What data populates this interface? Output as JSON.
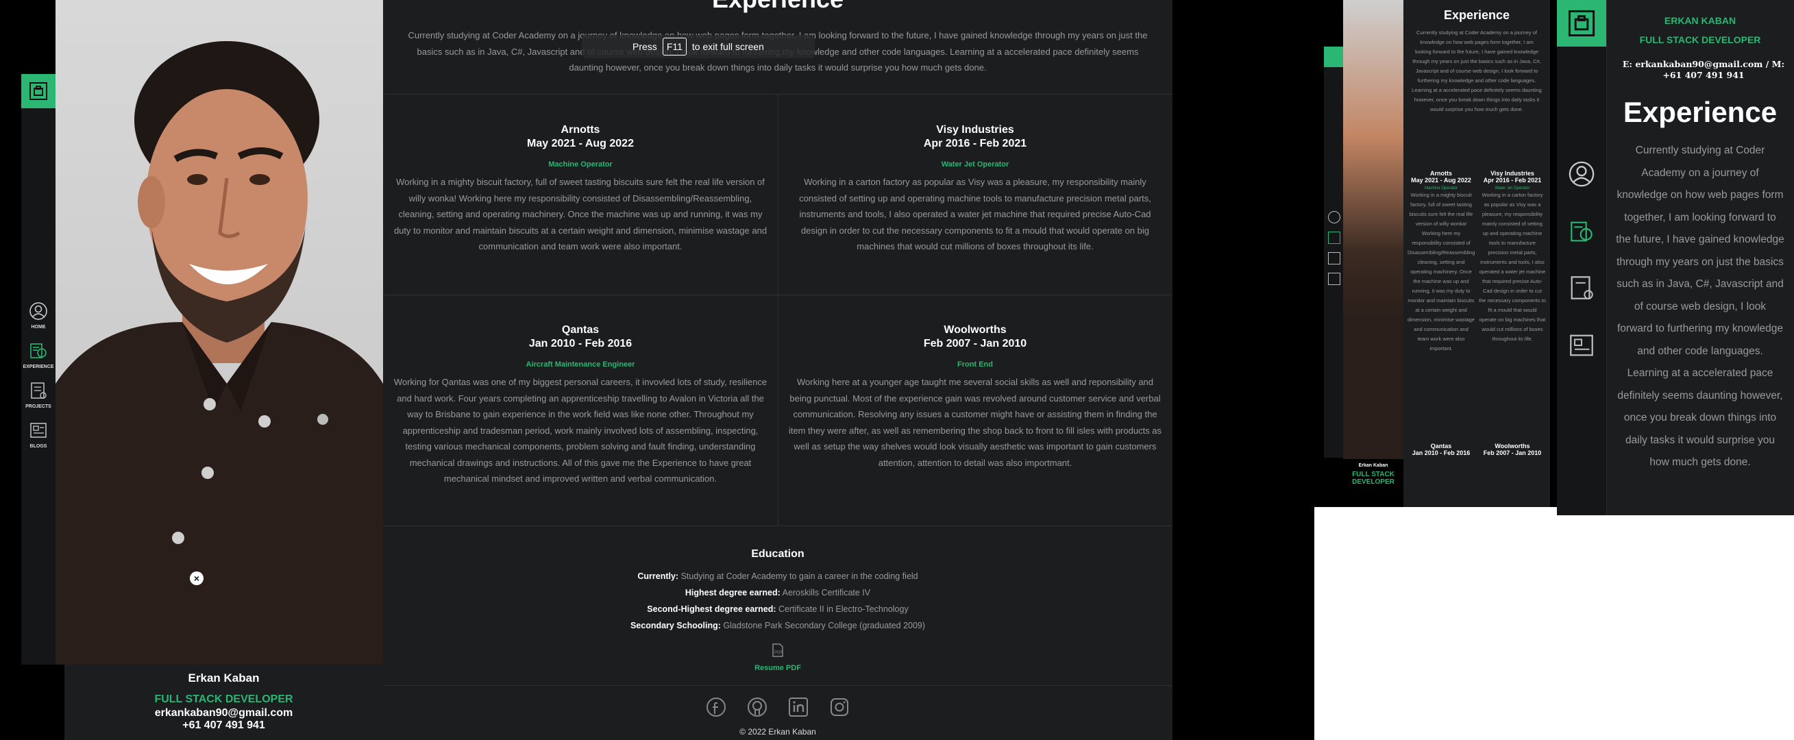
{
  "profile": {
    "name": "Erkan Kaban",
    "name_upper": "ERKAN KABAN",
    "role": "FULL STACK DEVELOPER",
    "email": "erkankaban90@gmail.com",
    "phone": "+61 407 491 941",
    "contact_line": "E: erkankaban90@gmail.com / M: +61 407 491 941"
  },
  "nav": {
    "items": [
      {
        "label": "HOME",
        "icon": "user-icon"
      },
      {
        "label": "EXPERIENCE",
        "icon": "resume-icon"
      },
      {
        "label": "PROJECTS",
        "icon": "blueprint-icon"
      },
      {
        "label": "BLOGS",
        "icon": "blog-icon"
      }
    ]
  },
  "fullscreen_hint": {
    "press": "Press",
    "key": "F11",
    "rest": "to exit full screen"
  },
  "experience": {
    "heading": "Experience",
    "intro": "Currently studying at Coder Academy on a journey of knowledge on how web pages form together, I am looking forward to the future, I have gained knowledge through my years on just the basics such as in Java, C#, Javascript and of course web design, I look forward to furthering my knowledge and other code languages. Learning at a accelerated pace definitely seems daunting however, once you break down things into daily tasks it would surprise you how much gets done.",
    "jobs": [
      {
        "company": "Arnotts",
        "dates": "May 2021 - Aug 2022",
        "role": "Machine Operator",
        "desc": "Working in a mighty biscuit factory, full of sweet tasting biscuits sure felt the real life version of willy wonka! Working here my responsibility consisted of Disassembling/Reassembling, cleaning, setting and operating machinery. Once the machine was up and running, it was my duty to monitor and maintain biscuits at a certain weight and dimension, minimise wastage and communication and team work were also important."
      },
      {
        "company": "Visy Industries",
        "dates": "Apr 2016 - Feb 2021",
        "role": "Water Jet Operator",
        "desc": "Working in a carton factory as popular as Visy was a pleasure, my responsibility mainly consisted of setting up and operating machine tools to manufacture precision metal parts, instruments and tools, I also operated a water jet machine that required precise Auto-Cad design in order to cut the necessary components to fit a mould that would operate on big machines that would cut millions of boxes throughout its life."
      },
      {
        "company": "Qantas",
        "dates": "Jan 2010 - Feb 2016",
        "role": "Aircraft Maintenance Engineer",
        "desc": "Working for Qantas was one of my biggest personal careers, it invovled lots of study, resilience and hard work. Four years completing an apprenticeship travelling to Avalon in Victoria all the way to Brisbane to gain experience in the work field was like none other. Throughout my apprenticeship and tradesman period, work mainly involved lots of assembling, inspecting, testing various mechanical components, problem solving and fault finding, understanding mechanical drawings and instructions. All of this gave me the Experience to have great mechanical mindset and improved written and verbal communication."
      },
      {
        "company": "Woolworths",
        "dates": "Feb 2007 - Jan 2010",
        "role": "Front End",
        "desc": "Working here at a younger age taught me several social skills as well and reponsibility and being punctual. Most of the experience gain was revolved around customer service and verbal communication. Resolving any issues a customer might have or assisting them in finding the item they were after, as well as remembering the shop back to front to fill isles with products as well as setup the way shelves would look visually aesthetic was important to gain customers attention, attention to detail was also importmant."
      }
    ]
  },
  "education": {
    "heading": "Education",
    "rows": [
      {
        "label": "Currently:",
        "value": "Studying at Coder Academy to gain a career in the coding field"
      },
      {
        "label": "Highest degree earned:",
        "value": "Aeroskills Certificate IV"
      },
      {
        "label": "Second-Highest degree earned:",
        "value": "Certificate II in Electro-Technology"
      },
      {
        "label": "Secondary Schooling:",
        "value": "Gladstone Park Secondary College (graduated 2009)"
      }
    ],
    "resume_label": "Resume PDF"
  },
  "footer": {
    "copyright": "© 2022 Erkan Kaban",
    "socials": [
      "facebook-icon",
      "github-icon",
      "linkedin-icon",
      "instagram-icon"
    ]
  },
  "colors": {
    "accent": "#2bb673",
    "panel": "#1c1d1f",
    "sidebar": "#151617"
  }
}
